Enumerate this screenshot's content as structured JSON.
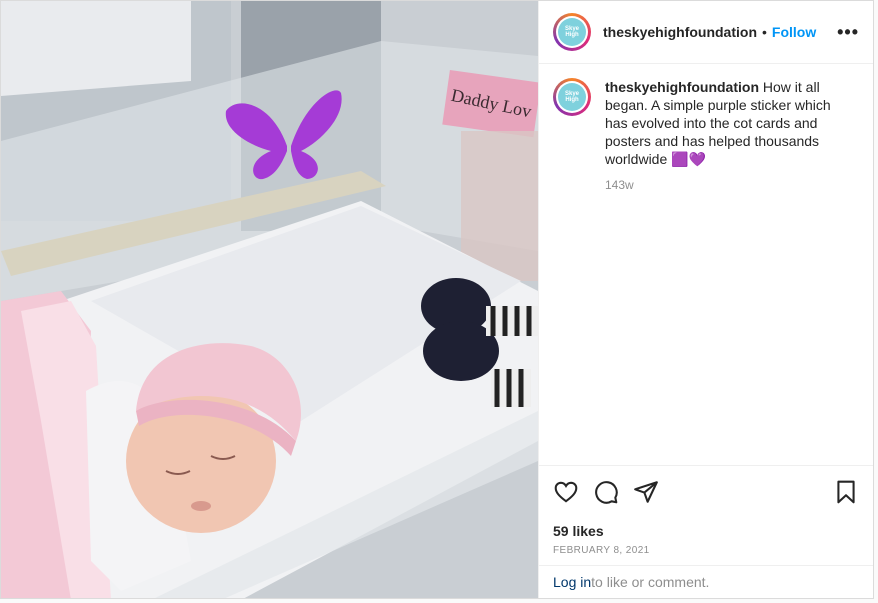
{
  "header": {
    "username": "theskyehighfoundation",
    "separator": "•",
    "follow_label": "Follow",
    "more_label": "•••",
    "avatar_text": "Skye High"
  },
  "caption": {
    "username": "theskyehighfoundation",
    "text": " How it all began. A simple purple sticker which has evolved into the cot cards and posters and has helped thousands worldwide 🟪💜",
    "age": "143w"
  },
  "photo": {
    "sign_text": "Daddy Lov"
  },
  "actions": {
    "icons": [
      "heart-icon",
      "comment-icon",
      "share-icon",
      "bookmark-icon"
    ],
    "likes": "59 likes",
    "date": "FEBRUARY 8, 2021"
  },
  "footer": {
    "login_link": "Log in",
    "login_rest": " to like or comment."
  },
  "colors": {
    "accent": "#0095f6",
    "sticker": "#a53bd6",
    "hat": "#f2c6d2"
  }
}
